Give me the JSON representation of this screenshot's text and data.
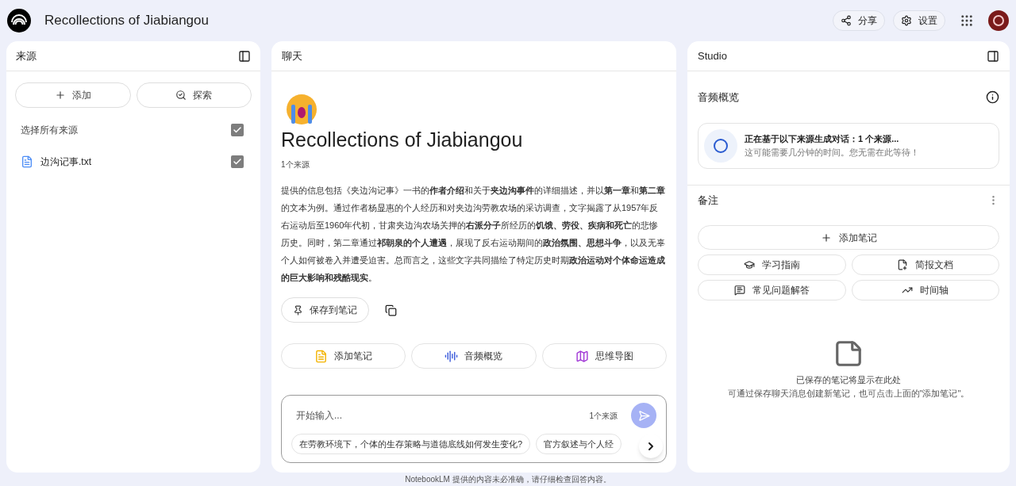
{
  "header": {
    "title": "Recollections of Jiabiangou",
    "buttons": [
      {
        "kind": "share",
        "label": "分享"
      },
      {
        "kind": "settings",
        "label": "设置"
      }
    ]
  },
  "sources": {
    "title": "来源",
    "actions": [
      {
        "kind": "add",
        "label": "添加"
      },
      {
        "kind": "explore",
        "label": "探索"
      }
    ],
    "select_all": {
      "label": "选择所有来源",
      "checked": true
    },
    "items": [
      {
        "name": "边沟记事.txt",
        "checked": true
      }
    ]
  },
  "chat": {
    "title": "聊天",
    "notebook_title": "Recollections of Jiabiangou",
    "source_count": "1个来源",
    "summary": "提供的信息包括《夹边沟记事》一书的**作者介绍**和关于**夹边沟事件**的详细描述，并以**第一章**和**第二章**的文本为例。通过作者杨显惠的个人经历和对夹边沟劳教农场的采访调查，文字揭露了从1957年反右运动后至1960年代初，甘肃夹边沟农场关押的**右派分子**所经历的**饥饿、劳役、疾病和死亡**的悲惨历史。同时，第二章通过**祁朝泉的个人遭遇**，展现了反右运动期间的**政治氛围、思想斗争**，以及无辜个人如何被卷入并遭受迫害。总而言之，这些文字共同描绘了特定历史时期**政治运动对个体命运造成的巨大影响和残酷现实**。",
    "save_button": "保存到笔记",
    "actions": [
      {
        "kind": "note",
        "label": "添加笔记"
      },
      {
        "kind": "audio",
        "label": "音频概览"
      },
      {
        "kind": "mindmap",
        "label": "思维导图"
      }
    ],
    "input": {
      "placeholder": "开始输入...",
      "source_count": "1个来源"
    },
    "suggestions": [
      "在劳教环境下，个体的生存策略与道德底线如何发生变化?",
      "官方叙述与个人经"
    ]
  },
  "studio": {
    "title": "Studio",
    "audio": {
      "title": "音频概览",
      "status_title": "正在基于以下来源生成对话：1 个来源...",
      "status_text": "这可能需要几分钟的时间。您无需在此等待！"
    },
    "notes": {
      "title": "备注",
      "add_button": "添加笔记",
      "tools": [
        {
          "kind": "guide",
          "label": "学习指南"
        },
        {
          "kind": "brief",
          "label": "简报文档"
        },
        {
          "kind": "faq",
          "label": "常见问题解答"
        },
        {
          "kind": "timeline",
          "label": "时间轴"
        }
      ],
      "empty_title": "已保存的笔记将显示在此处",
      "empty_text": "可通过保存聊天消息创建新笔记，也可点击上面的\"添加笔记\"。"
    }
  },
  "footer": "NotebookLM 提供的内容未必准确，请仔细检查回答内容。"
}
